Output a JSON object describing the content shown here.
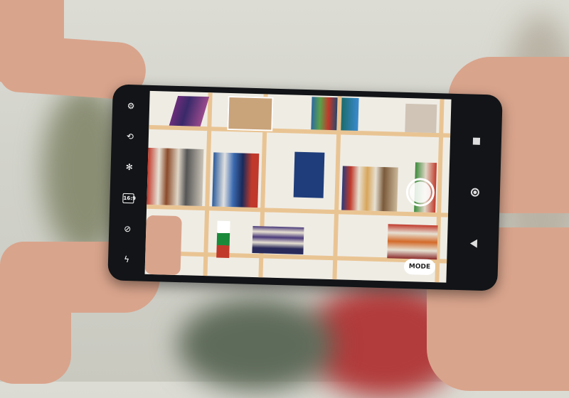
{
  "camera": {
    "sidebar_icons": [
      "settings-icon",
      "switch-camera-icon",
      "brightness-icon",
      "aspect-ratio-icon",
      "flash-off-icon",
      "flash-auto-icon"
    ],
    "aspect_ratio_label": "16:9",
    "mode_label": "MODE"
  },
  "colors": {
    "phone_body": "#121417",
    "shelf_wood": "#e9c493",
    "skin": "#d9a48c"
  }
}
